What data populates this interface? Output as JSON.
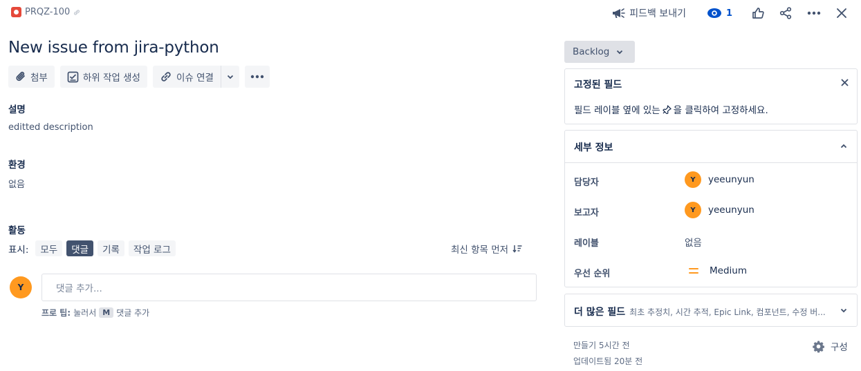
{
  "header": {
    "issue_key": "PRQZ-100",
    "feedback_label": "피드백 보내기",
    "watch_count": "1"
  },
  "issue": {
    "title": "New issue from jira-python"
  },
  "actions": {
    "attach": "첨부",
    "create_subtask": "하위 작업 생성",
    "link_issue": "이슈 연결"
  },
  "description": {
    "label": "설명",
    "value": "editted description"
  },
  "environment": {
    "label": "환경",
    "value": "없음"
  },
  "activity": {
    "label": "활동",
    "show_label": "표시:",
    "filters": [
      "모두",
      "댓글",
      "기록",
      "작업 로그"
    ],
    "active_filter": "댓글",
    "sort_label": "최신 항목 먼저",
    "comment_placeholder": "댓글 추가...",
    "protip_prefix": "프로 팁:",
    "protip_press": "눌러서",
    "protip_key": "M",
    "protip_suffix": "댓글 추가",
    "avatar_initial": "Y"
  },
  "status": {
    "label": "Backlog"
  },
  "pinned_fields": {
    "title": "고정된 필드",
    "hint_before": "필드 레이블 옆에 있는",
    "hint_after": "을 클릭하여 고정하세요."
  },
  "details": {
    "title": "세부 정보",
    "assignee_label": "담당자",
    "assignee": "yeeunyun",
    "reporter_label": "보고자",
    "reporter": "yeeunyun",
    "labels_label": "레이블",
    "labels_value": "없음",
    "priority_label": "우선 순위",
    "priority": "Medium",
    "avatar_initial": "Y"
  },
  "more_fields": {
    "title": "더 많은 필드",
    "summary": "최초 추정치, 시간 추적, Epic Link, 컴포넌트, 수정 버..."
  },
  "footer": {
    "created": "만들기 5시간 전",
    "updated": "업데이트됨 20분 전",
    "configure": "구성"
  },
  "colors": {
    "accent": "#0052cc",
    "bug": "#e5493a",
    "avatar": "#ff991f",
    "priority_medium": "#ff991f"
  }
}
